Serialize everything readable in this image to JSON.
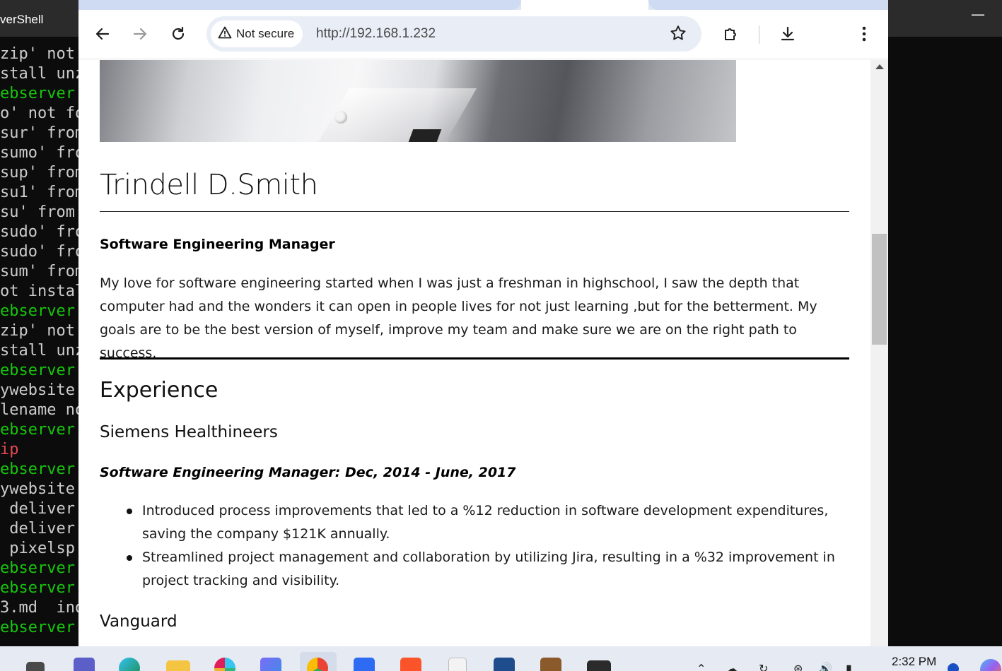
{
  "terminal": {
    "title": "verShell",
    "lines": [
      {
        "text": "zip' not",
        "color": "white"
      },
      {
        "text": "stall unz",
        "color": "white"
      },
      {
        "text": "ebserver:",
        "color": "green"
      },
      {
        "text": "o' not fo",
        "color": "white"
      },
      {
        "text": "sur' from",
        "color": "white"
      },
      {
        "text": "sumo' fro",
        "color": "white"
      },
      {
        "text": "sup' from",
        "color": "white"
      },
      {
        "text": "su1' from",
        "color": "white"
      },
      {
        "text": "su' from",
        "color": "white"
      },
      {
        "text": "sudo' fro",
        "color": "white"
      },
      {
        "text": "sudo' fro",
        "color": "white"
      },
      {
        "text": "sum' from",
        "color": "white"
      },
      {
        "text": "ot instal",
        "color": "white"
      },
      {
        "text": "ebserver:",
        "color": "green"
      },
      {
        "text": "zip' not",
        "color": "white"
      },
      {
        "text": "stall unz",
        "color": "white"
      },
      {
        "text": "ebserver:",
        "color": "green"
      },
      {
        "text": "ywebsite.",
        "color": "white"
      },
      {
        "text": "lename no",
        "color": "white"
      },
      {
        "text": "ebserver:",
        "color": "green"
      },
      {
        "text": "ip",
        "color": "red"
      },
      {
        "text": "ebserver:",
        "color": "green"
      },
      {
        "text": "ywebsite.",
        "color": "white"
      },
      {
        "text": " deliver",
        "color": "white"
      },
      {
        "text": " deliver",
        "color": "white"
      },
      {
        "text": " pixelsp",
        "color": "white"
      },
      {
        "text": "ebserver:",
        "color": "green"
      },
      {
        "text": "ebserver:",
        "color": "green"
      },
      {
        "text": "3.md  ind",
        "color": "white"
      },
      {
        "text": "ebserver:",
        "color": "green"
      }
    ]
  },
  "browser": {
    "security_label": "Not secure",
    "url": "http://192.168.1.232"
  },
  "page": {
    "name": "Trindell D.Smith",
    "role": "Software Engineering Manager",
    "bio": "My love for software engineering started when I was just a freshman in highschool, I saw the depth that computer had and the wonders it can open in people lives for not just learning ,but for the betterment. My goals are to be the best version of myself, improve my team and make sure we are on the right path to success.",
    "experience_heading": "Experience",
    "jobs": [
      {
        "company": "Siemens Healthineers",
        "title": "Software Engineering Manager: Dec, 2014 - June, 2017",
        "bullets": [
          "Introduced process improvements that led to a %12 reduction in software development expenditures, saving the company $121K annually.",
          "Streamlined project management and collaboration by utilizing Jira, resulting in a %32 improvement in project tracking and visibility."
        ]
      },
      {
        "company": "Vanguard"
      }
    ]
  },
  "taskbar": {
    "clock": "2:32 PM",
    "apps": [
      "start-icon",
      "teams-icon",
      "edge-icon",
      "file-explorer-icon",
      "slack-icon",
      "copilot-icon",
      "chrome-icon",
      "vscode-icon",
      "brave-icon",
      "notepad-icon",
      "virtualbox-icon",
      "winrar-icon",
      "terminal-icon"
    ]
  }
}
